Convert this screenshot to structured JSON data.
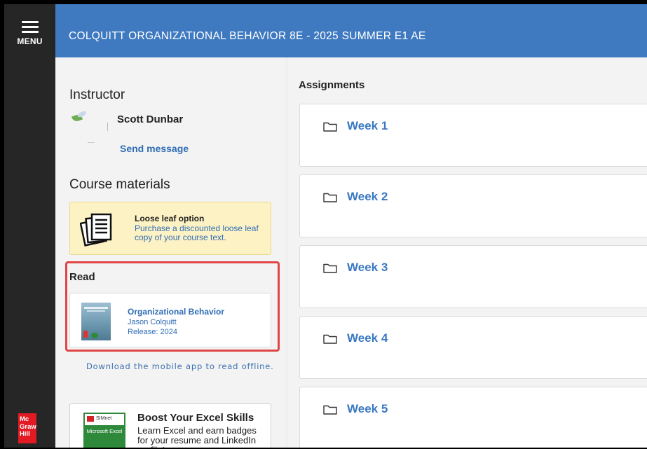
{
  "menu": {
    "label": "MENU"
  },
  "brand": {
    "logo_text": [
      "Mc",
      "Graw",
      "Hill"
    ]
  },
  "header": {
    "course_title": "COLQUITT ORGANIZATIONAL BEHAVIOR 8E - 2025 SUMMER E1 AE"
  },
  "instructor": {
    "heading": "Instructor",
    "name": "Scott Dunbar",
    "send_message": "Send message"
  },
  "materials": {
    "heading": "Course materials",
    "loose_leaf": {
      "title": "Loose leaf option",
      "description": "Purchase a discounted loose leaf copy of your course text."
    }
  },
  "read": {
    "heading": "Read",
    "book": {
      "title": "Organizational Behavior",
      "author": "Jason Colquitt",
      "release": "Release: 2024"
    },
    "mobile_link": "Download the mobile app to read offline."
  },
  "excel": {
    "badge_top": "SIMnet",
    "badge_body": "Microsoft Excel",
    "title": "Boost Your Excel Skills",
    "description": "Learn Excel and earn badges for your resume and LinkedIn profile!"
  },
  "assignments": {
    "heading": "Assignments",
    "weeks": [
      {
        "label": "Week 1"
      },
      {
        "label": "Week 2"
      },
      {
        "label": "Week 3"
      },
      {
        "label": "Week 4"
      },
      {
        "label": "Week 5"
      }
    ]
  },
  "colors": {
    "header": "#3f7ac1",
    "rail": "#262626",
    "link": "#2f6db5",
    "highlight_border": "#e04646",
    "loose_leaf_bg": "#fdf2c4",
    "brand_red": "#e21a23"
  }
}
